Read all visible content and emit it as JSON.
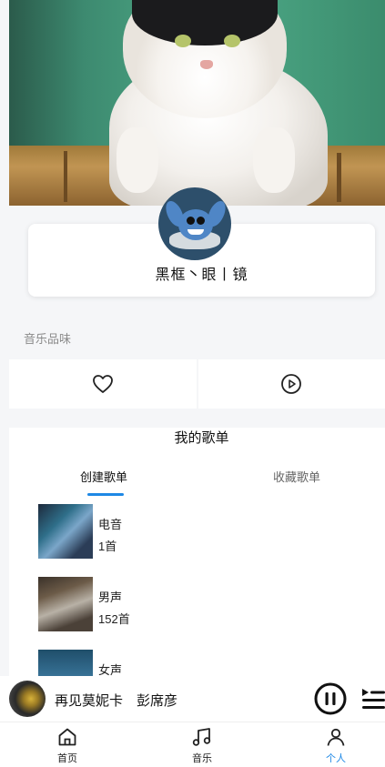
{
  "profile": {
    "username": "黑框丶眼丨镜"
  },
  "taste": {
    "section_title": "音乐品味",
    "items": [
      {
        "icon": "heart-icon"
      },
      {
        "icon": "play-circle-icon"
      }
    ]
  },
  "playlists": {
    "title": "我的歌单",
    "tabs": [
      {
        "label": "创建歌单",
        "active": true
      },
      {
        "label": "收藏歌单",
        "active": false
      }
    ],
    "items": [
      {
        "name": "电音",
        "count": "1首"
      },
      {
        "name": "男声",
        "count": "152首"
      },
      {
        "name": "女声",
        "count": ""
      }
    ]
  },
  "player": {
    "title": "再见莫妮卡",
    "artist": "彭席彦",
    "state": "playing"
  },
  "tabbar": {
    "items": [
      {
        "label": "首页",
        "icon": "home-icon",
        "active": false
      },
      {
        "label": "音乐",
        "icon": "music-note-icon",
        "active": false
      },
      {
        "label": "个人",
        "icon": "person-icon",
        "active": true
      }
    ]
  },
  "colors": {
    "accent": "#1e88e5",
    "background": "#f5f6f8"
  }
}
